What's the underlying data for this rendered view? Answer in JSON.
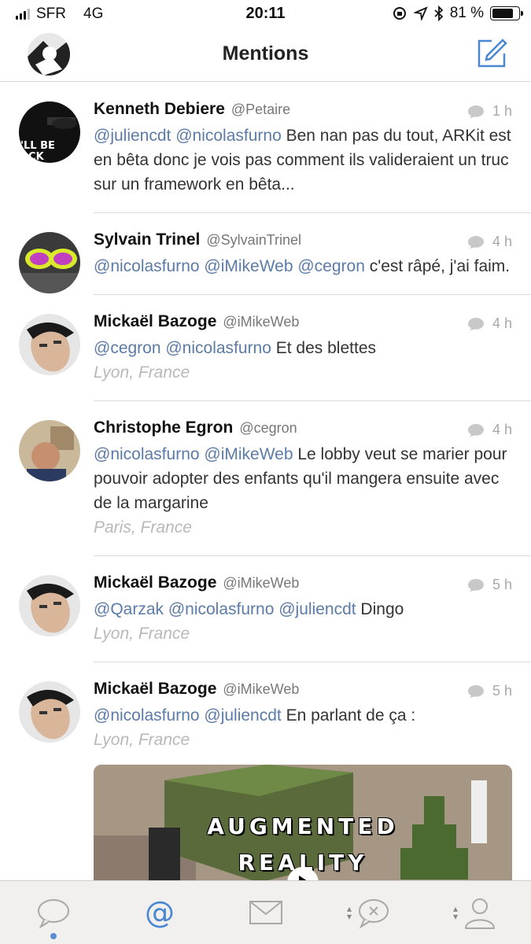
{
  "status_bar": {
    "carrier": "SFR",
    "network": "4G",
    "time": "20:11",
    "battery": "81 %",
    "battery_level": 0.81
  },
  "nav": {
    "title": "Mentions"
  },
  "tweets": [
    {
      "name": "Kenneth Debiere",
      "handle": "@Petaire",
      "time": "1 h",
      "mentions": "@juliencdt @nicolasfurno",
      "text": " Ben nan pas du tout, ARKit est en bêta donc je vois pas comment ils valideraient un truc sur un framework en bêta...",
      "location": ""
    },
    {
      "name": "Sylvain Trinel",
      "handle": "@SylvainTrinel",
      "time": "4 h",
      "mentions": "@nicolasfurno @iMikeWeb @cegron",
      "text": " c'est râpé, j'ai faim.",
      "location": ""
    },
    {
      "name": "Mickaël Bazoge",
      "handle": "@iMikeWeb",
      "time": "4 h",
      "mentions": "@cegron @nicolasfurno",
      "text": " Et des blettes",
      "location": "Lyon, France"
    },
    {
      "name": "Christophe Egron",
      "handle": "@cegron",
      "time": "4 h",
      "mentions": "@nicolasfurno @iMikeWeb",
      "text": " Le lobby veut se marier pour pouvoir adopter des enfants qu'il mangera ensuite avec de la margarine",
      "location": "Paris, France"
    },
    {
      "name": "Mickaël Bazoge",
      "handle": "@iMikeWeb",
      "time": "5 h",
      "mentions": "@Qarzak @nicolasfurno @juliencdt",
      "text": " Dingo",
      "location": "Lyon, France"
    },
    {
      "name": "Mickaël Bazoge",
      "handle": "@iMikeWeb",
      "time": "5 h",
      "mentions": "@nicolasfurno @juliencdt",
      "text": " En parlant de ça :",
      "location": "Lyon, France",
      "media_caption_1": "AUGMENTED",
      "media_caption_2": "REALITY"
    }
  ],
  "tabs": [
    "timeline-icon",
    "mentions-icon",
    "messages-icon",
    "activity-icon",
    "profile-icon"
  ]
}
